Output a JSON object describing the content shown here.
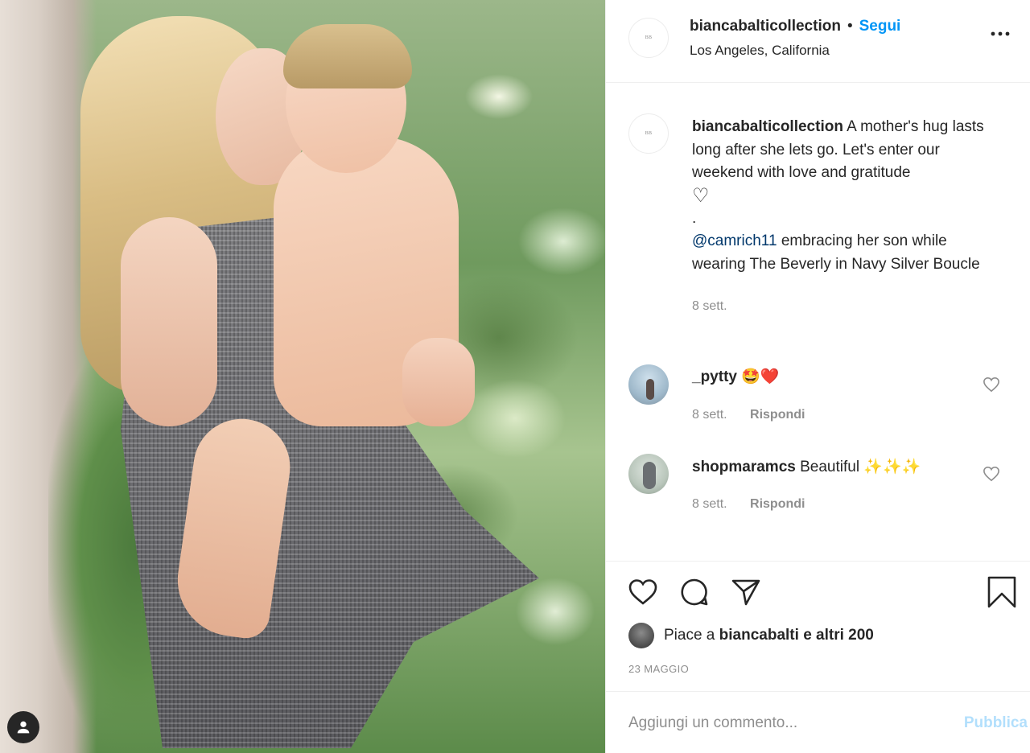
{
  "post": {
    "username": "biancabalticollection",
    "follow_label": "Segui",
    "separator": "•",
    "location": "Los Angeles, California",
    "more_icon": "more-horizontal-icon"
  },
  "caption": {
    "username": "biancabalticollection",
    "text": "A mother's hug lasts long after she lets go. Let's enter our weekend with love and gratitude",
    "heart": "♡",
    "dot": ".",
    "mention": "@camrich11",
    "text2": "embracing her son while wearing The Beverly in Navy Silver Boucle",
    "time": "8 sett."
  },
  "comments": [
    {
      "username": "_pytty",
      "text": "🤩❤️",
      "time": "8 sett.",
      "reply": "Rispondi"
    },
    {
      "username": "shopmaramcs",
      "text": "Beautiful ✨✨✨",
      "time": "8 sett.",
      "reply": "Rispondi"
    }
  ],
  "likes": {
    "prefix": "Piace a",
    "user": "biancabalti",
    "suffix": "e altri 200"
  },
  "date": "23 MAGGIO",
  "comment_input": {
    "placeholder": "Aggiungi un commento...",
    "publish_label": "Pubblica"
  },
  "colors": {
    "accent": "#0095f6",
    "publish_disabled": "#b2dffc",
    "text": "#262626",
    "muted": "#8e8e8e",
    "mention": "#00376b"
  }
}
